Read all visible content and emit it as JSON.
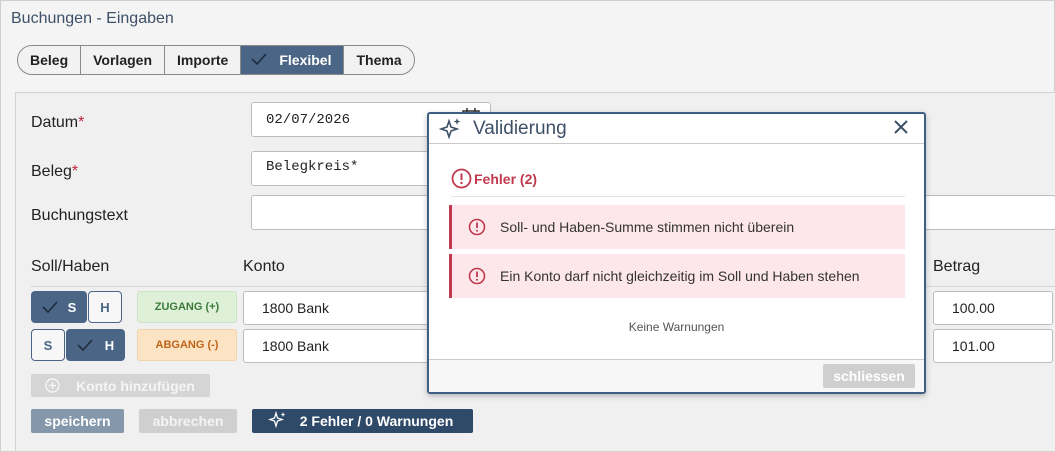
{
  "window": {
    "title": "Buchungen - Eingaben"
  },
  "tabs": [
    {
      "label": "Beleg",
      "active": false
    },
    {
      "label": "Vorlagen",
      "active": false
    },
    {
      "label": "Importe",
      "active": false
    },
    {
      "label": "Flexibel",
      "active": true
    },
    {
      "label": "Thema",
      "active": false
    }
  ],
  "form": {
    "datum_label": "Datum",
    "datum_value": "02/07/2026",
    "beleg_label": "Beleg",
    "beleg_value": "Belegkreis*",
    "buchungstext_label": "Buchungstext",
    "buchungstext_value": "",
    "required_mark": "*"
  },
  "columns": {
    "soll_haben": "Soll/Haben",
    "konto": "Konto",
    "betrag": "Betrag"
  },
  "rows": [
    {
      "s": "S",
      "h": "H",
      "selected": "S",
      "chip": "ZUGANG (+)",
      "konto": "1800 Bank",
      "betrag": "100.00"
    },
    {
      "s": "S",
      "h": "H",
      "selected": "H",
      "chip": "ABGANG (-)",
      "konto": "1800 Bank",
      "betrag": "101.00"
    }
  ],
  "actions": {
    "add_konto": "Konto hinzufügen",
    "save": "speichern",
    "cancel": "abbrechen",
    "validation": "2 Fehler / 0 Warnungen"
  },
  "dialog": {
    "title": "Validierung",
    "errors_heading": "Fehler (2)",
    "errors": [
      "Soll- und Haben-Summe stimmen nicht überein",
      "Ein Konto darf nicht gleichzeitig im Soll und Haben stehen"
    ],
    "no_warnings": "Keine Warnungen",
    "close_button": "schliessen"
  },
  "colors": {
    "accent": "#4a6585",
    "error": "#c0394f",
    "zugang_bg": "#dff0d8",
    "abgang_bg": "#fbe3c3"
  }
}
